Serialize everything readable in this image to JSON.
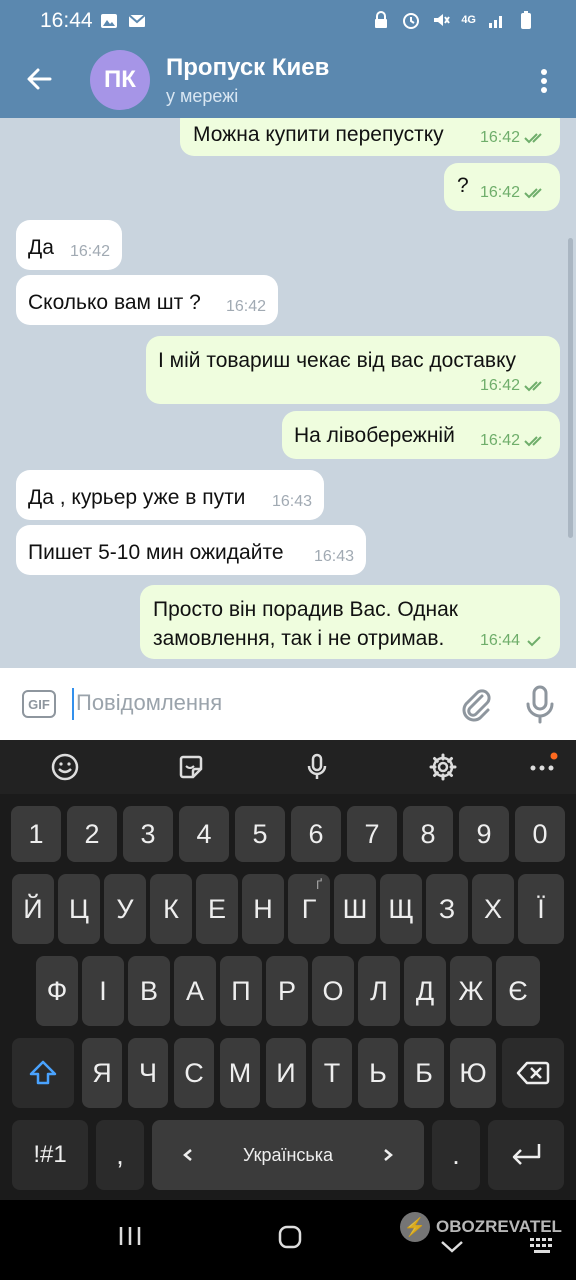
{
  "status": {
    "time": "16:44",
    "network": "4G"
  },
  "header": {
    "avatar_initials": "ПК",
    "title": "Пропуск Киев",
    "subtitle": "у мережі"
  },
  "messages": [
    {
      "dir": "out",
      "text": "Можна купити перепустку",
      "time": "16:42",
      "status": "read"
    },
    {
      "dir": "out",
      "text": "?",
      "time": "16:42",
      "status": "read"
    },
    {
      "dir": "in",
      "text": "Да",
      "time": "16:42"
    },
    {
      "dir": "in",
      "text": "Сколько вам шт ?",
      "time": "16:42"
    },
    {
      "dir": "out",
      "text": "І мій товариш чекає від вас доставку",
      "time": "16:42",
      "status": "read"
    },
    {
      "dir": "out",
      "text": "На лівобережній",
      "time": "16:42",
      "status": "read"
    },
    {
      "dir": "in",
      "text": "Да , курьер уже в пути",
      "time": "16:43"
    },
    {
      "dir": "in",
      "text": "Пишет 5-10 мин ожидайте",
      "time": "16:43"
    },
    {
      "dir": "out",
      "text_line1": "Просто він порадив Вас. Однак",
      "text_line2": "замовлення, так і не отримав.",
      "time": "16:44",
      "status": "sent"
    }
  ],
  "input": {
    "gif_label": "GIF",
    "placeholder": "Повідомлення"
  },
  "keyboard": {
    "numbers": [
      "1",
      "2",
      "3",
      "4",
      "5",
      "6",
      "7",
      "8",
      "9",
      "0"
    ],
    "row1": [
      "Й",
      "Ц",
      "У",
      "К",
      "Е",
      "Н",
      "Г",
      "Ш",
      "Щ",
      "З",
      "Х",
      "Ї"
    ],
    "row1_hint_g": "Ґ",
    "row2": [
      "Ф",
      "І",
      "В",
      "А",
      "П",
      "Р",
      "О",
      "Л",
      "Д",
      "Ж",
      "Є"
    ],
    "row3": [
      "Я",
      "Ч",
      "С",
      "М",
      "И",
      "Т",
      "Ь",
      "Б",
      "Ю"
    ],
    "symbols": "!#1",
    "comma": ",",
    "space_label": "Українська",
    "period": "."
  },
  "watermark": {
    "text": "OBOZREVATEL"
  },
  "colors": {
    "header": "#5b88af",
    "outgoing_bubble": "#effdde",
    "incoming_bubble": "#ffffff",
    "accent": "#3390ec"
  }
}
